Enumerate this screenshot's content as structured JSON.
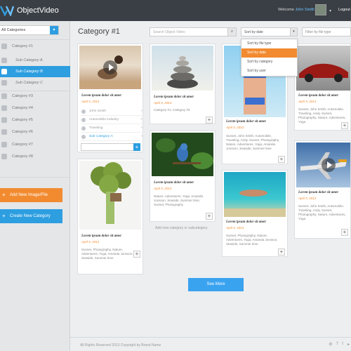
{
  "app": {
    "name": "ObjectVideo",
    "welcome": "Welcome",
    "user": "John Smith",
    "logout": "Logout"
  },
  "sidebar": {
    "select_value": "All Categories",
    "items": [
      {
        "label": "Category #1",
        "sub": false,
        "active": false
      },
      {
        "label": "Sub Category A",
        "sub": true,
        "active": false
      },
      {
        "label": "Sub Category B",
        "sub": true,
        "active": true
      },
      {
        "label": "Sub Category C",
        "sub": true,
        "active": false
      },
      {
        "label": "Category #3",
        "sub": false,
        "active": false
      },
      {
        "label": "Category #4",
        "sub": false,
        "active": false
      },
      {
        "label": "Category #5",
        "sub": false,
        "active": false
      },
      {
        "label": "Category #6",
        "sub": false,
        "active": false
      },
      {
        "label": "Category #7",
        "sub": false,
        "active": false
      },
      {
        "label": "Category #8",
        "sub": false,
        "active": false
      }
    ],
    "add_button": "Add New Image/File",
    "create_button": "Create New Category"
  },
  "main": {
    "title": "Category #1",
    "search_placeholder": "Search Object Video",
    "sort_value": "Sort by date",
    "filter_value": "Filter by file type",
    "sort_options": [
      "Sort by file type",
      "Sort by date",
      "Sort by category",
      "Sort by user"
    ],
    "add_category_link": "Add new category or subcategory",
    "see_more": "See More"
  },
  "cards": {
    "c1": {
      "title": "Lorem ipsum dolor sit amet",
      "date": "April 5, 2013",
      "tags": [
        "John Smith",
        "Automobile industry",
        "Traveling",
        "Sub Category A"
      ]
    },
    "c2": {
      "title": "Lorem ipsum dolor sit amet",
      "date": "April 5, 2013",
      "desc": "Sunset, Photography, Nature, Adventures, Yoga, Amanda Jonsson, Seaside, Summer time"
    },
    "c3": {
      "title": "Lorem ipsum dolor sit amet",
      "date": "April 5, 2013",
      "desc": "Category #1, Category #3"
    },
    "c4": {
      "title": "Lorem ipsum dolor sit amet",
      "date": "April 5, 2013",
      "desc": "Nature, Adventures, Yoga, Amanda Jonsson, Seaside, Summer time, Sunset, Photography"
    },
    "c5": {
      "title": "Lorem ipsum dolor sit amet",
      "date": "April 5, 2013",
      "desc": "Sunset, John Smith, Automobile, Traveling, Andy, Sunset, Photography, Nature, Adventures, Yoga, Amanda Jonsson, Seaside, Summer time"
    },
    "c6": {
      "title": "Lorem ipsum dolor sit amet",
      "date": "April 5, 2013",
      "desc": "Sunset, Photography, Nature, Adventures, Yoga, Amanda Jonsson, Seaside, Summer time"
    },
    "c7": {
      "title": "Lorem ipsum dolor sit amet",
      "date": "April 5, 2013",
      "desc": "Sunset, John Smith, Automobile, Traveling, Andy, Sunset, Photography, Nature, Adventures, Yoga"
    },
    "c8": {
      "title": "Lorem ipsum dolor sit amet",
      "date": "April 5, 2013",
      "desc": "Sunset, John Smith, Automobile, Traveling, Andy, Sunset, Photography, Nature, Adventures, Yoga"
    }
  },
  "footer": {
    "copyright": "All Rights Reserved 2013 Copyright by Brand Name"
  },
  "colors": {
    "accent_blue": "#2d9ee0",
    "accent_orange": "#f28b30",
    "header_bg": "#3a3f45"
  }
}
